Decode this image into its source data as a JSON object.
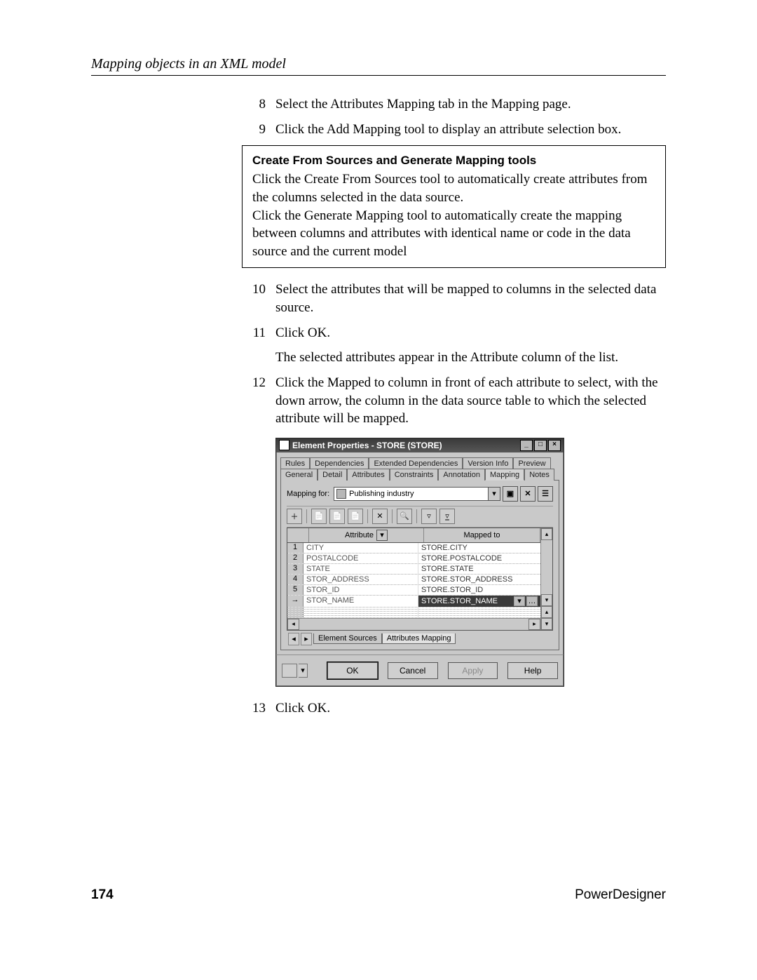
{
  "header": {
    "section_title": "Mapping objects in an XML model"
  },
  "steps": {
    "s8": {
      "n": "8",
      "t": "Select the Attributes Mapping tab in the Mapping page."
    },
    "s9": {
      "n": "9",
      "t": "Click the Add Mapping tool to display an attribute selection box."
    },
    "s10": {
      "n": "10",
      "t": "Select the attributes that will be mapped to columns in the selected data source."
    },
    "s11": {
      "n": "11",
      "t": "Click OK."
    },
    "s11p": "The selected attributes appear in the Attribute column of the list.",
    "s12": {
      "n": "12",
      "t": "Click the Mapped to column in front of each attribute to select, with the down arrow, the column in the data source table to which the selected attribute will be mapped."
    },
    "s13": {
      "n": "13",
      "t": "Click OK."
    }
  },
  "note": {
    "title": "Create From Sources and Generate Mapping tools",
    "body": "Click the Create From Sources tool to automatically create attributes from the columns selected in the data source.\nClick the Generate Mapping tool to automatically create the mapping between columns and attributes with identical name or code in the data source and the current model"
  },
  "dialog": {
    "title": "Element Properties - STORE (STORE)",
    "tabs_row1": [
      "Rules",
      "Dependencies",
      "Extended Dependencies",
      "Version Info",
      "Preview"
    ],
    "tabs_row2": [
      "General",
      "Detail",
      "Attributes",
      "Constraints",
      "Annotation",
      "Mapping",
      "Notes"
    ],
    "active_tab": "Mapping",
    "mapping_for_label": "Mapping for:",
    "mapping_for_value": "Publishing industry",
    "grid_headers": {
      "attr": "Attribute",
      "mapped": "Mapped to"
    },
    "rows": [
      {
        "n": "1",
        "attr": "CITY",
        "mapped": "STORE.CITY"
      },
      {
        "n": "2",
        "attr": "POSTALCODE",
        "mapped": "STORE.POSTALCODE"
      },
      {
        "n": "3",
        "attr": "STATE",
        "mapped": "STORE.STATE"
      },
      {
        "n": "4",
        "attr": "STOR_ADDRESS",
        "mapped": "STORE.STOR_ADDRESS"
      },
      {
        "n": "5",
        "attr": "STOR_ID",
        "mapped": "STORE.STOR_ID"
      },
      {
        "n": "→",
        "attr": "STOR_NAME",
        "mapped": "STORE.STOR_NAME"
      }
    ],
    "bottom_tabs": [
      "Element Sources",
      "Attributes Mapping"
    ],
    "active_bottom_tab": "Attributes Mapping",
    "buttons": {
      "ok": "OK",
      "cancel": "Cancel",
      "apply": "Apply",
      "help": "Help"
    }
  },
  "footer": {
    "page": "174",
    "product": "PowerDesigner"
  }
}
